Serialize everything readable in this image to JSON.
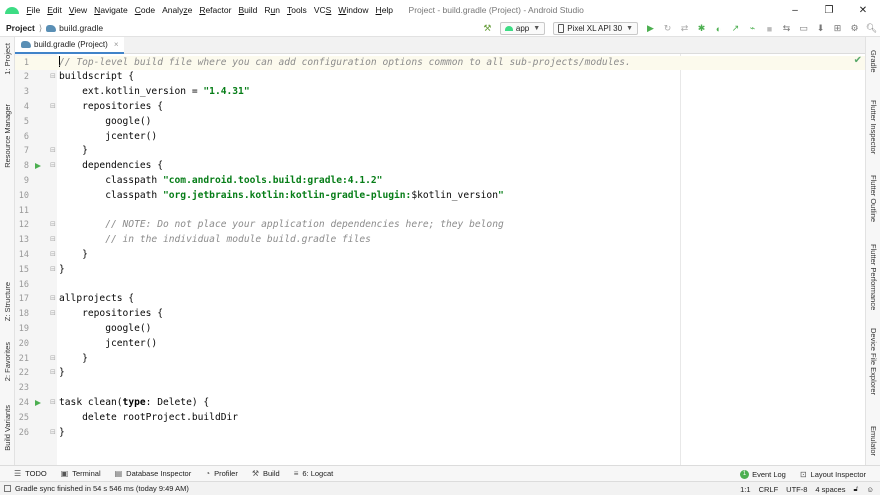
{
  "titlebar": {
    "menus": [
      {
        "pre": "",
        "u": "F",
        "post": "ile"
      },
      {
        "pre": "",
        "u": "E",
        "post": "dit"
      },
      {
        "pre": "",
        "u": "V",
        "post": "iew"
      },
      {
        "pre": "",
        "u": "N",
        "post": "avigate"
      },
      {
        "pre": "",
        "u": "C",
        "post": "ode"
      },
      {
        "pre": "Analy",
        "u": "z",
        "post": "e"
      },
      {
        "pre": "",
        "u": "R",
        "post": "efactor"
      },
      {
        "pre": "",
        "u": "B",
        "post": "uild"
      },
      {
        "pre": "R",
        "u": "u",
        "post": "n"
      },
      {
        "pre": "",
        "u": "T",
        "post": "ools"
      },
      {
        "pre": "VC",
        "u": "S",
        "post": ""
      },
      {
        "pre": "",
        "u": "W",
        "post": "indow"
      },
      {
        "pre": "",
        "u": "H",
        "post": "elp"
      }
    ],
    "window_title": "Project - build.gradle (Project) - Android Studio",
    "minimize": "–",
    "maximize": "❐",
    "close": "✕"
  },
  "navbar": {
    "project": "Project",
    "separator": "⟩",
    "file": "build.gradle",
    "run_config": "app",
    "device": "Pixel XL API 30"
  },
  "left_tabs": [
    "1: Project",
    "Resource Manager",
    "Z: Structure",
    "2: Favorites",
    "Build Variants"
  ],
  "right_tabs": [
    "Gradle",
    "Flutter Inspector",
    "Flutter Outline",
    "Flutter Performance",
    "Device File Explorer",
    "Emulator"
  ],
  "editor": {
    "tab_label": "build.gradle (Project)",
    "tab_close": "×",
    "lines": [
      {
        "n": "1",
        "parts": [
          {
            "t": "// Top-level build file where you can add configuration options common to all sub-projects/modules.",
            "c": "tok-comment"
          }
        ],
        "caret": true
      },
      {
        "n": "2",
        "parts": [
          {
            "t": "buildscript {",
            "c": "tok-plain"
          }
        ]
      },
      {
        "n": "3",
        "parts": [
          {
            "t": "    ext.kotlin_version = ",
            "c": "tok-plain"
          },
          {
            "t": "\"1.4.31\"",
            "c": "tok-string"
          }
        ]
      },
      {
        "n": "4",
        "parts": [
          {
            "t": "    repositories {",
            "c": "tok-plain"
          }
        ]
      },
      {
        "n": "5",
        "parts": [
          {
            "t": "        google()",
            "c": "tok-plain"
          }
        ]
      },
      {
        "n": "6",
        "parts": [
          {
            "t": "        jcenter()",
            "c": "tok-plain"
          }
        ]
      },
      {
        "n": "7",
        "parts": [
          {
            "t": "    }",
            "c": "tok-plain"
          }
        ]
      },
      {
        "n": "8",
        "parts": [
          {
            "t": "    dependencies {",
            "c": "tok-plain"
          }
        ],
        "run": true
      },
      {
        "n": "9",
        "parts": [
          {
            "t": "        classpath ",
            "c": "tok-plain"
          },
          {
            "t": "\"com.android.tools.build:gradle:4.1.2\"",
            "c": "tok-string"
          }
        ]
      },
      {
        "n": "10",
        "parts": [
          {
            "t": "        classpath ",
            "c": "tok-plain"
          },
          {
            "t": "\"org.jetbrains.kotlin:kotlin-gradle-plugin:",
            "c": "tok-string"
          },
          {
            "t": "$kotlin_version",
            "c": "tok-plain"
          },
          {
            "t": "\"",
            "c": "tok-string"
          }
        ]
      },
      {
        "n": "11",
        "parts": []
      },
      {
        "n": "12",
        "parts": [
          {
            "t": "        // NOTE: Do not place your application dependencies here; they belong",
            "c": "tok-comment"
          }
        ]
      },
      {
        "n": "13",
        "parts": [
          {
            "t": "        // in the individual module build.gradle files",
            "c": "tok-comment"
          }
        ]
      },
      {
        "n": "14",
        "parts": [
          {
            "t": "    }",
            "c": "tok-plain"
          }
        ]
      },
      {
        "n": "15",
        "parts": [
          {
            "t": "}",
            "c": "tok-plain"
          }
        ]
      },
      {
        "n": "16",
        "parts": []
      },
      {
        "n": "17",
        "parts": [
          {
            "t": "allprojects {",
            "c": "tok-plain"
          }
        ]
      },
      {
        "n": "18",
        "parts": [
          {
            "t": "    repositories {",
            "c": "tok-plain"
          }
        ]
      },
      {
        "n": "19",
        "parts": [
          {
            "t": "        google()",
            "c": "tok-plain"
          }
        ]
      },
      {
        "n": "20",
        "parts": [
          {
            "t": "        jcenter()",
            "c": "tok-plain"
          }
        ]
      },
      {
        "n": "21",
        "parts": [
          {
            "t": "    }",
            "c": "tok-plain"
          }
        ]
      },
      {
        "n": "22",
        "parts": [
          {
            "t": "}",
            "c": "tok-plain"
          }
        ]
      },
      {
        "n": "23",
        "parts": []
      },
      {
        "n": "24",
        "parts": [
          {
            "t": "task clean(",
            "c": "tok-plain"
          },
          {
            "t": "type",
            "c": "tok-kw"
          },
          {
            "t": ": Delete) {",
            "c": "tok-plain"
          }
        ],
        "run": true
      },
      {
        "n": "25",
        "parts": [
          {
            "t": "    delete rootProject.buildDir",
            "c": "tok-plain"
          }
        ]
      },
      {
        "n": "26",
        "parts": [
          {
            "t": "}",
            "c": "tok-plain"
          }
        ]
      }
    ],
    "fold_lines": [
      2,
      4,
      7,
      8,
      12,
      13,
      14,
      15,
      17,
      18,
      21,
      22,
      24,
      26
    ]
  },
  "bottom_tools": [
    {
      "icon": "☰",
      "icon_name": "todo-icon",
      "label": "TODO"
    },
    {
      "icon": "▣",
      "icon_name": "terminal-icon",
      "label": "Terminal"
    },
    {
      "icon": "▤",
      "icon_name": "database-icon",
      "label": "Database Inspector"
    },
    {
      "icon": "◔",
      "icon_name": "profiler-icon",
      "label": "Profiler"
    },
    {
      "icon": "⚒",
      "icon_name": "build-icon",
      "label": "Build"
    },
    {
      "icon": "≡",
      "icon_name": "logcat-icon",
      "label": "6: Logcat"
    }
  ],
  "bottom_right": {
    "event_log": "Event Log",
    "event_badge": "1",
    "layout_inspector": "Layout Inspector"
  },
  "statusbar": {
    "message": "Gradle sync finished in 54 s 546 ms (today 9:49 AM)",
    "position": "1:1",
    "line_sep": "CRLF",
    "encoding": "UTF-8",
    "indent": "4 spaces"
  },
  "colors": {
    "accent": "#4083c9",
    "android_green": "#3ddc84",
    "string_green": "#067d17"
  }
}
